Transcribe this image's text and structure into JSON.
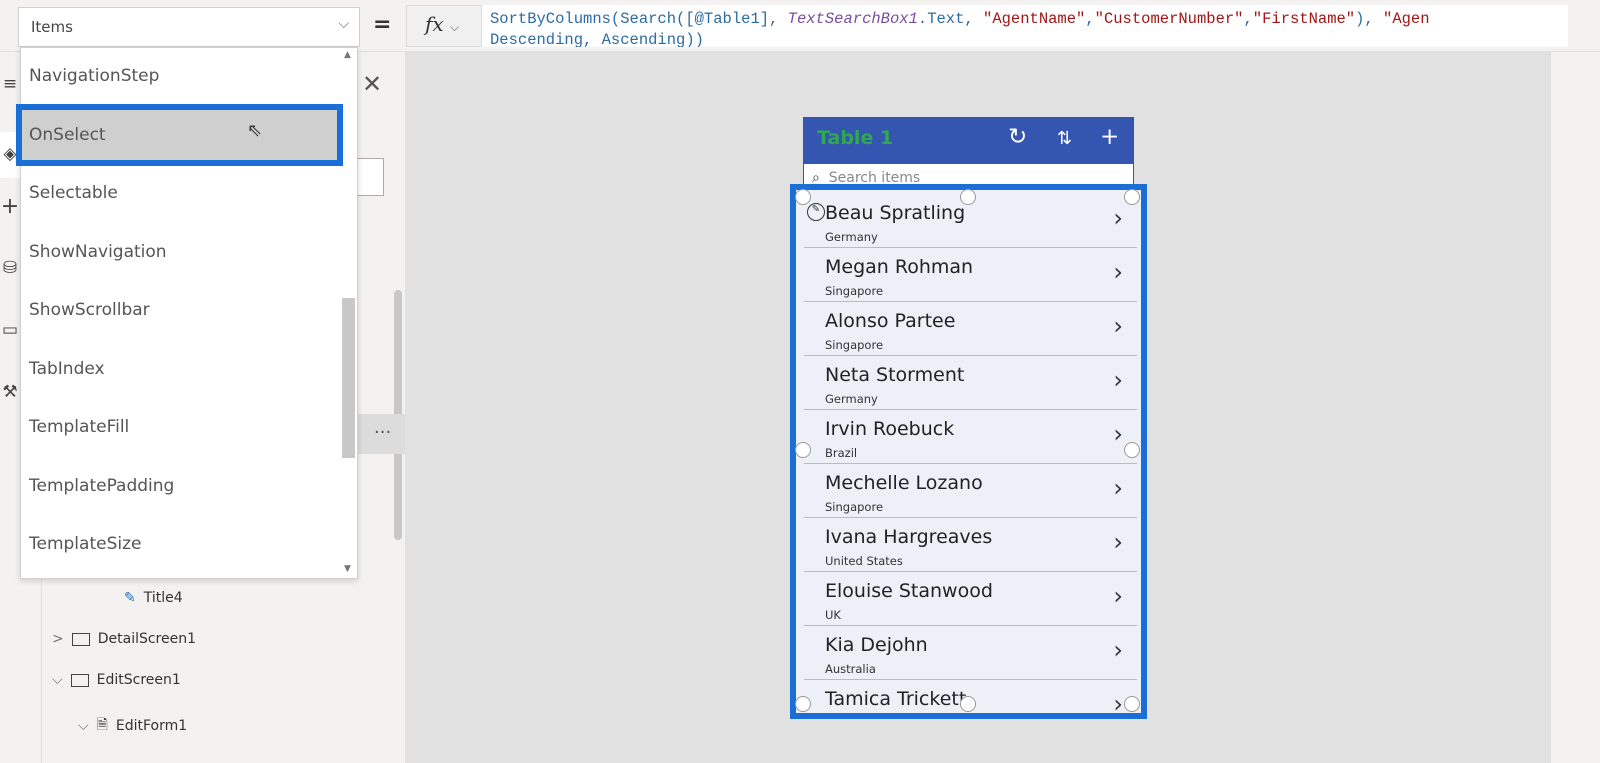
{
  "formula_bar": {
    "property": "Items",
    "equals": "=",
    "fx": "fx",
    "fx_chevron": "⌵",
    "line1": [
      {
        "t": "SortByColumns(Search([@Table1], ",
        "c": "kw"
      },
      {
        "t": "TextSearchBox1",
        "c": "id"
      },
      {
        "t": ".Text, ",
        "c": "kw"
      },
      {
        "t": "\"AgentName\"",
        "c": "str"
      },
      {
        "t": ",",
        "c": "kw"
      },
      {
        "t": "\"CustomerNumber\"",
        "c": "str"
      },
      {
        "t": ",",
        "c": "kw"
      },
      {
        "t": "\"FirstName\"",
        "c": "str"
      },
      {
        "t": "), ",
        "c": "kw"
      },
      {
        "t": "\"Agen",
        "c": "str"
      }
    ],
    "line2": "Descending, Ascending))"
  },
  "property_dropdown": {
    "items": [
      "NavigationStep",
      "OnSelect",
      "Selectable",
      "ShowNavigation",
      "ShowScrollbar",
      "TabIndex",
      "TemplateFill",
      "TemplatePadding",
      "TemplateSize"
    ],
    "selected": "OnSelect"
  },
  "tree": {
    "items": [
      {
        "label": "Title4",
        "icon": "edit-label-icon"
      },
      {
        "label": "DetailScreen1",
        "icon": "screen-icon",
        "chevron": ">"
      },
      {
        "label": "EditScreen1",
        "icon": "screen-icon",
        "chevron": "⌵"
      },
      {
        "label": "EditForm1",
        "icon": "form-icon",
        "chevron": "⌵"
      }
    ],
    "more": "···"
  },
  "app": {
    "title": "Table 1",
    "search_placeholder": "Search items",
    "rows": [
      {
        "name": "Beau Spratling",
        "country": "Germany"
      },
      {
        "name": "Megan Rohman",
        "country": "Singapore"
      },
      {
        "name": "Alonso Partee",
        "country": "Singapore"
      },
      {
        "name": "Neta Storment",
        "country": "Germany"
      },
      {
        "name": "Irvin Roebuck",
        "country": "Brazil"
      },
      {
        "name": "Mechelle Lozano",
        "country": "Singapore"
      },
      {
        "name": "Ivana Hargreaves",
        "country": "United States"
      },
      {
        "name": "Elouise Stanwood",
        "country": "UK"
      },
      {
        "name": "Kia Dejohn",
        "country": "Australia"
      },
      {
        "name": "Tamica Trickett",
        "country": ""
      }
    ]
  },
  "colors": {
    "selection": "#1a6fd6",
    "header": "#3556b0",
    "title": "#2fa84f"
  }
}
